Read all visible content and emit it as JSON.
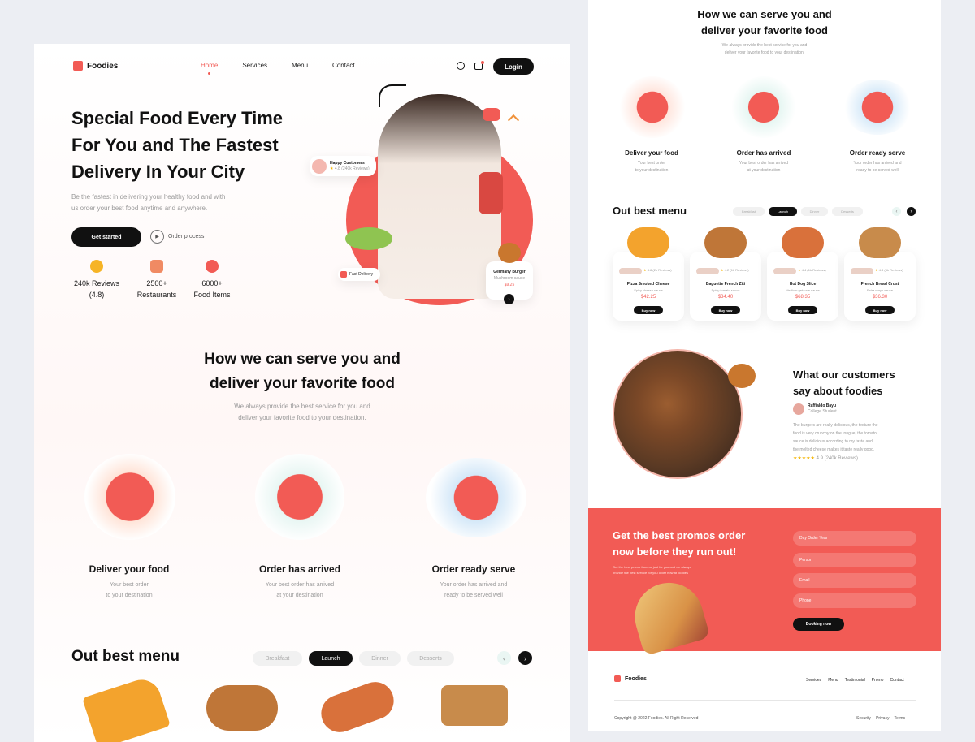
{
  "brand": {
    "name": "Foodies",
    "accent": "#f25b55",
    "dark": "#111111"
  },
  "nav": {
    "home": "Home",
    "services": "Services",
    "menu": "Menu",
    "contact": "Contact",
    "login": "Login"
  },
  "hero": {
    "title_lines": [
      "Special Food Every Time",
      "For You and The Fastest",
      "Delivery In Your City"
    ],
    "subtitle_lines": [
      "Be the fastest in delivering your healthy food and with",
      "us order your best food anytime and anywhere."
    ],
    "cta": "Get started",
    "secondary": "Order process",
    "stats": [
      {
        "value": "240k Reviews",
        "extra": "(4.8)"
      },
      {
        "value": "2500+",
        "extra": "Restaurants"
      },
      {
        "value": "6000+",
        "extra": "Food Items"
      }
    ],
    "badge": {
      "title": "Happy Customers",
      "rating": "4.8",
      "reviews": "(240k Reviews)"
    },
    "delivery": "Fast Delivery",
    "burger": {
      "name": "Germany Burger",
      "desc": "Mushroom sauce",
      "price": "$9.25"
    }
  },
  "serve": {
    "title_lines": [
      "How we can serve you and",
      "deliver your favorite food"
    ],
    "subtitle_lines": [
      "We always provide the best service for you and",
      "deliver your favorite food to your destination."
    ],
    "items": [
      {
        "title": "Deliver your food",
        "desc": [
          "Your best order",
          "to your destination"
        ]
      },
      {
        "title": "Order has arrived",
        "desc": [
          "Your best order has arrived",
          "at your destination"
        ]
      },
      {
        "title": "Order ready serve",
        "desc": [
          "Your order has arrived and",
          "ready to be served well"
        ]
      }
    ]
  },
  "menu": {
    "title": "Out best menu",
    "tabs": [
      "Breakfast",
      "Launch",
      "Dinner",
      "Desserts"
    ],
    "items": [
      {
        "name": "Pizza Smoked Cheese",
        "desc": "Spicy cheese sauce",
        "rating": "4.8",
        "reviews": "(2k Reviews)",
        "price": "$42.25",
        "action": "Buy now"
      },
      {
        "name": "Baguette French Ziti",
        "desc": "Spicy tomato sauce",
        "rating": "4.2",
        "reviews": "(1k Reviews)",
        "price": "$34.40",
        "action": "Buy now"
      },
      {
        "name": "Hot Dog Slice",
        "desc": "Medium getaone sauce",
        "rating": "4.4",
        "reviews": "(1k Reviews)",
        "price": "$68.35",
        "action": "Buy now"
      },
      {
        "name": "French Bread Crust",
        "desc": "Extra mayo sauce",
        "rating": "4.8",
        "reviews": "(5k Reviews)",
        "price": "$36.30",
        "action": "Buy now"
      }
    ]
  },
  "testimonial": {
    "title_lines": [
      "What our customers",
      "say about foodies"
    ],
    "name": "Raffialdo Bayu",
    "role": "College Student",
    "text_lines": [
      "The burgers are really delicious, the texture the",
      "food is very crunchy on the tongue, the tomato",
      "sauce is delicious according to my taste and",
      "the melted cheese makes it taste really good."
    ],
    "rating": "4.9",
    "reviews": "(240k Reviews)"
  },
  "promo": {
    "title_lines": [
      "Get the best promos order",
      "now before they run out!"
    ],
    "text_lines": [
      "Get the best promo from us just for you and we always",
      "provide the best service for you order now at foodies"
    ],
    "fields": [
      "Day Order Year",
      "Person",
      "Email",
      "Phone"
    ],
    "button": "Booking now"
  },
  "footer": {
    "links": [
      "Services",
      "Menu",
      "Testimonial",
      "Promo",
      "Contact"
    ],
    "copyright": "Copyright @ 2022 Foodies. All Right Reserved",
    "legal": [
      "Security",
      "Privacy",
      "Terms"
    ]
  }
}
